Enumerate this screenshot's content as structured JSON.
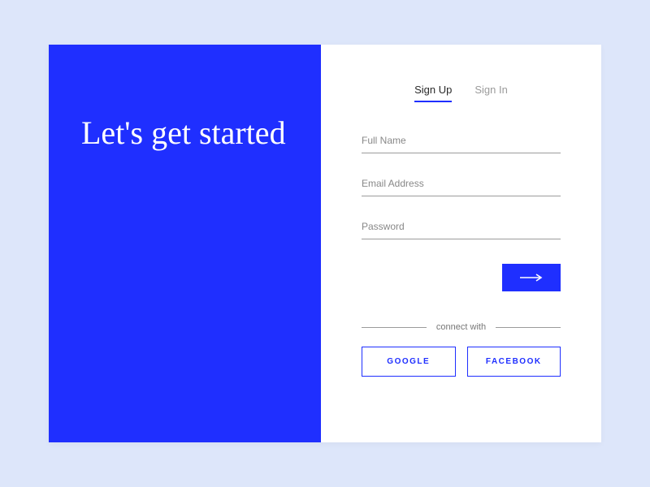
{
  "colors": {
    "primary": "#1F2FFF",
    "page_bg": "#dde6fa"
  },
  "left": {
    "heading": "Let's get started"
  },
  "tabs": {
    "signup": "Sign Up",
    "signin": "Sign In",
    "active": "signup"
  },
  "form": {
    "fullname_placeholder": "Full Name",
    "email_placeholder": "Email Address",
    "password_placeholder": "Password",
    "fullname_value": "",
    "email_value": "",
    "password_value": ""
  },
  "connect": {
    "label": "connect with"
  },
  "social": {
    "google": "GOOGLE",
    "facebook": "FACEBOOK"
  }
}
